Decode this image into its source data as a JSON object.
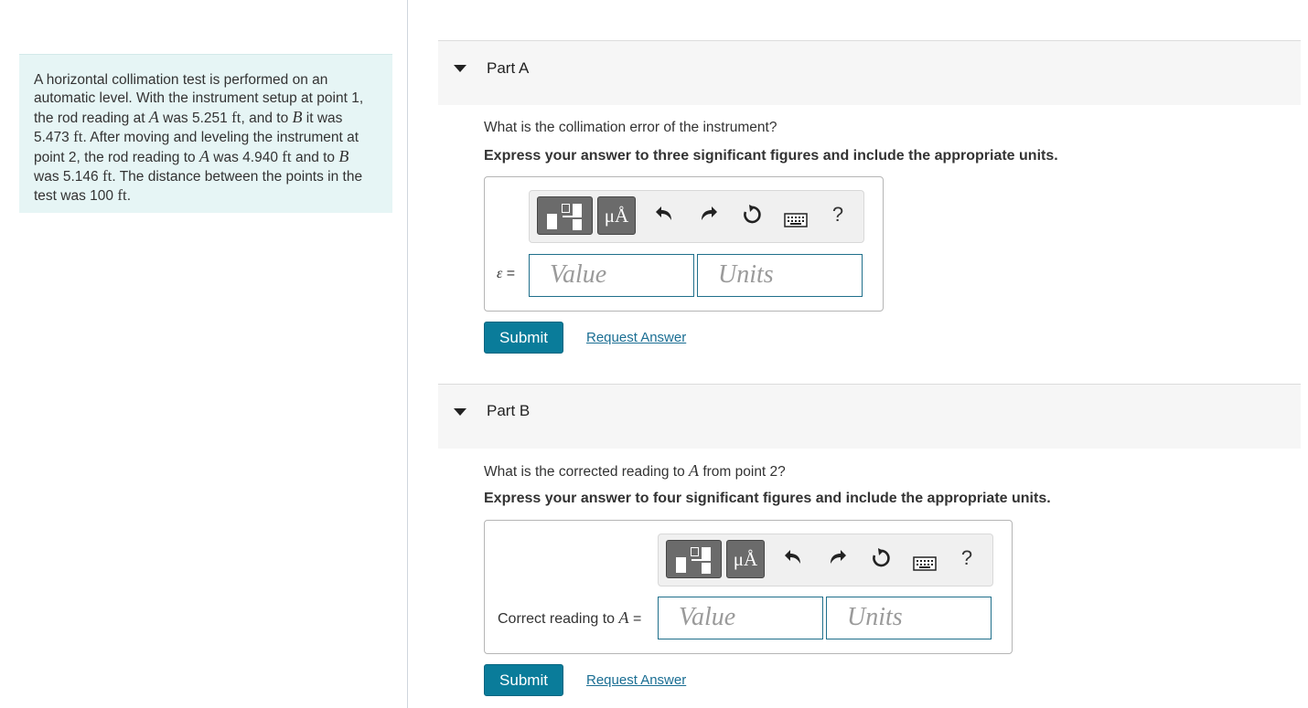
{
  "problem": {
    "segments": [
      {
        "t": "A horizontal collimation test is performed on an automatic level. With the instrument setup at point 1, the rod reading at "
      },
      {
        "m": "A"
      },
      {
        "t": " was 5.251 "
      },
      {
        "u": "ft"
      },
      {
        "t": ", and to "
      },
      {
        "m": "B"
      },
      {
        "t": " it was 5.473 "
      },
      {
        "u": "ft"
      },
      {
        "t": ". After moving and leveling the instrument at point 2, the rod reading to "
      },
      {
        "m": "A"
      },
      {
        "t": " was 4.940 "
      },
      {
        "u": "ft"
      },
      {
        "t": " and to "
      },
      {
        "m": "B"
      },
      {
        "t": " was 5.146 "
      },
      {
        "u": "ft"
      },
      {
        "t": ". The distance between the points in the test was 100 "
      },
      {
        "u": "ft"
      },
      {
        "t": "."
      }
    ]
  },
  "parts": [
    {
      "title": "Part A",
      "question_pre": "What is the collimation error of the instrument?",
      "question_var": "",
      "question_post": "",
      "instruction": "Express your answer to three significant figures and include the appropriate units.",
      "answer_label_pre": "",
      "answer_label_var": "ε",
      "answer_label_post": " =",
      "value_placeholder": "Value",
      "units_placeholder": "Units",
      "mu_label": "μÅ",
      "help_label": "?",
      "submit_label": "Submit",
      "request_label": "Request Answer"
    },
    {
      "title": "Part B",
      "question_pre": "What is the corrected reading to ",
      "question_var": "A",
      "question_post": " from point 2?",
      "instruction": "Express your answer to four significant figures and include the appropriate units.",
      "answer_label_pre": "Correct reading to ",
      "answer_label_var": "A",
      "answer_label_post": " =",
      "value_placeholder": "Value",
      "units_placeholder": "Units",
      "mu_label": "μÅ",
      "help_label": "?",
      "submit_label": "Submit",
      "request_label": "Request Answer"
    }
  ],
  "colors": {
    "accent": "#0a7c9a",
    "panel_bg": "#e6f5f5",
    "link": "#1a6e93",
    "field_border": "#1f6f8b"
  },
  "icons": [
    "templates-icon",
    "units-icon",
    "undo-icon",
    "redo-icon",
    "reset-icon",
    "keyboard-icon",
    "help-icon",
    "collapse-caret-icon"
  ]
}
